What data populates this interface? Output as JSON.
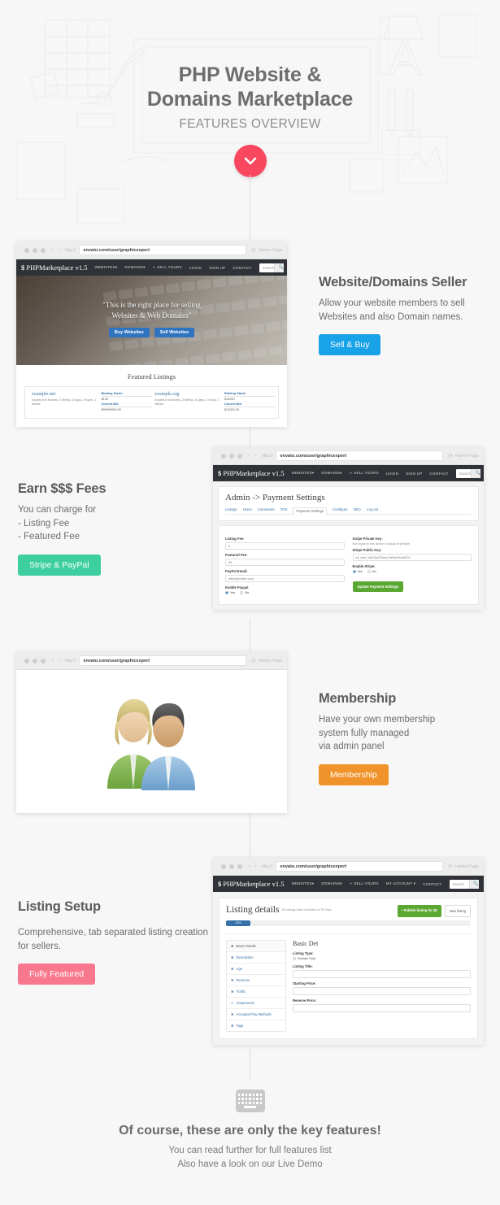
{
  "hero": {
    "title_line1": "PHP Website &",
    "title_line2": "Domains Marketplace",
    "subtitle": "FEATURES OVERVIEW",
    "scroll_icon": "chevron-down-icon"
  },
  "browser": {
    "url": "envato.com/user/graphicexpert",
    "protocol": "http://",
    "home_label": "Home Page",
    "back_forward": "‹  ›",
    "reload_icon": "reload-icon"
  },
  "site_nav": {
    "logo": "PHPMarketplace v1.5",
    "logo_icon": "dollar-icon",
    "items_public": [
      "WEBSITES▾",
      "DOMAINS▾",
      "➢ SELL YOURS",
      "LOGIN",
      "SIGN UP",
      "CONTACT"
    ],
    "items_member": [
      "WEBSITES▾",
      "DOMAINS▾",
      "➢ SELL YOURS",
      "MY ACCOUNT ▾",
      "CONTACT"
    ],
    "search_placeholder": "Search",
    "search_icon": "search-icon"
  },
  "section1": {
    "site_quote_line1": "\"This is the right place for selling",
    "site_quote_line2": "Websites & Web Domains\"",
    "btn_buy": "Buy Websites",
    "btn_sell": "Sell Websites",
    "featured_title": "Featured Listings",
    "listings": [
      {
        "name": "example.net",
        "meta": "Expires in 8 Months, 3 Weeks, 6 Days, 2 Hours, 1 Minute",
        "bid_start_label": "Bidding Starts",
        "bid_start_value": "$100",
        "current_bid_label": "Current Bid",
        "current_bid_value": "$99999999.99"
      },
      {
        "name": "example.org",
        "meta": "Expires in 8 Months, 3 Weeks, 6 Days, 2 Hours, 1 Minute",
        "bid_start_label": "Bidding Starts",
        "bid_start_value": "$10000",
        "current_bid_label": "Current Bid",
        "current_bid_value": "$12000.00"
      }
    ],
    "heading": "Website/Domains Seller",
    "body": "Allow your website members to sell Websites and also Domain names.",
    "button_label": "Sell & Buy",
    "button_color": "#18a3e8"
  },
  "section2": {
    "heading": "Earn $$$ Fees",
    "body_line1": "You can charge for",
    "body_line2": "- Listing Fee",
    "body_line3": "- Featured Fee",
    "button_label": "Stripe & PayPal",
    "button_color": "#3ecfa0",
    "admin": {
      "title": "Admin -> Payment Settings",
      "tabs": [
        "Listings",
        "Users",
        "Comments",
        "TOS",
        "Payment Settings",
        "Configure",
        "SEO",
        "Log out"
      ],
      "active_tab": "Payment Settings",
      "left_fields": [
        {
          "label": "Listing Fee:",
          "value": "5"
        },
        {
          "label": "Featured Fee:",
          "value": "50"
        },
        {
          "label": "PayPal Email:",
          "value": "office@crimix.com"
        }
      ],
      "paypal_toggle_label": "Enable Paypal",
      "stripe_private_label": "Stripe Private Key:",
      "stripe_private_note": "Not shown in this demo! It should be private!",
      "stripe_public_label": "Stripe Public Key:",
      "stripe_public_value": "pk_test_1IaGZyGShnuCW5yMGIx66OY",
      "stripe_toggle_label": "Enable Stripe:",
      "radio_yes": "Yes",
      "radio_no": "No",
      "submit_label": "Update Payment Settings"
    }
  },
  "section3": {
    "heading": "Membership",
    "body_line1": "Have your own membership",
    "body_line2": "system fully managed",
    "body_line3": "via admin panel",
    "button_label": "Membership",
    "button_color": "#f0932b",
    "illustration": "users-group-icon"
  },
  "section4": {
    "heading": "Listing Setup",
    "body": "Comprehensive, tab separated listing creation for sellers.",
    "button_label": "Fully Featured",
    "button_color": "#f8798d",
    "listing": {
      "title": "Listing details",
      "note": "All Listings have a duration of 30 Days",
      "progress_label": "10%",
      "progress_percent": 10,
      "publish_button": "• Publish listing for $5",
      "new_button": "New listing",
      "tabs": [
        {
          "label": "Basic Details",
          "icon": "close-icon",
          "active": true
        },
        {
          "label": "Description",
          "icon": "close-icon",
          "active": false
        },
        {
          "label": "Age",
          "icon": "close-icon",
          "active": false
        },
        {
          "label": "Revenue",
          "icon": "close-icon",
          "active": false
        },
        {
          "label": "Traffic",
          "icon": "close-icon",
          "active": false
        },
        {
          "label": "Uniqueness",
          "icon": "check-icon",
          "active": false
        },
        {
          "label": "Accepted Pay Methods",
          "icon": "close-icon",
          "active": false
        },
        {
          "label": "Tags",
          "icon": "close-icon",
          "active": false
        }
      ],
      "form_title": "Basic Det",
      "fields": [
        {
          "label": "Listing Type:",
          "value": "Domain Only",
          "type": "radio"
        },
        {
          "label": "Listing Title:",
          "value": "",
          "type": "text"
        },
        {
          "label": "Starting Price:",
          "value": "",
          "type": "text"
        },
        {
          "label": "Reserve Price:",
          "value": "",
          "type": "text"
        }
      ]
    }
  },
  "footer": {
    "icon": "keyboard-icon",
    "heading": "Of course, these are only the key features!",
    "line1": "You can read further for full features list",
    "line2": "Also have a look on our Live Demo"
  }
}
